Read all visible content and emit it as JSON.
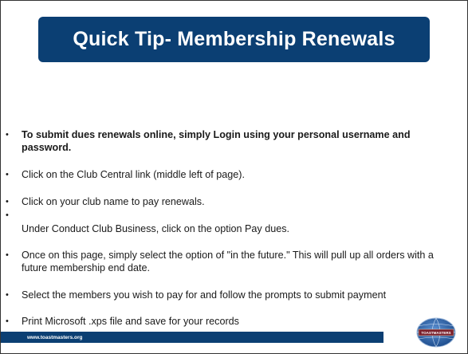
{
  "slide": {
    "title": "Quick Tip- Membership Renewals",
    "bullets": [
      {
        "text": "To submit dues renewals online, simply Login using your personal username and password.",
        "bold": true
      },
      {
        "text": "Click on the Club Central link (middle left of page).",
        "bold": false
      },
      {
        "text": "Click on your club name to pay renewals.",
        "bold": false
      },
      {
        "text": "",
        "bold": false
      },
      {
        "text": "Under Conduct Club Business, click on the option Pay dues.",
        "bold": false
      },
      {
        "text": "Once on this page, simply select the option of \"in the future.\" This will pull up all orders with a future membership end date.",
        "bold": false
      },
      {
        "text": "Select the members you wish to pay for and follow the prompts to submit payment",
        "bold": false
      },
      {
        "text": "Print Microsoft .xps file and save for your records",
        "bold": false
      }
    ],
    "bullet_glyph": "•",
    "footer": "www.toastmasters.org",
    "logo_text": "TOASTMASTERS",
    "colors": {
      "brand": "#0b3f73",
      "logo_maroon": "#7a1f2b",
      "logo_blue": "#1f5aa0"
    }
  }
}
